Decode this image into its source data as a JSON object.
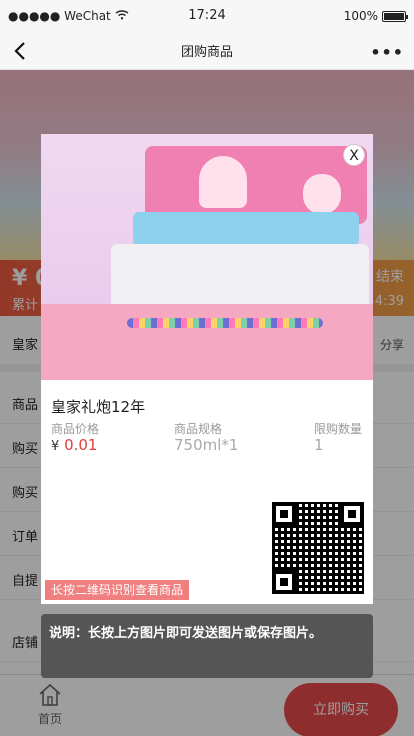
{
  "status_bar": {
    "carrier": "●●●●● WeChat",
    "time": "17:24",
    "battery": "100%"
  },
  "nav": {
    "title": "团购商品",
    "more": "•••"
  },
  "hero_bar": {
    "price_prefix": "¥ 0",
    "sub": "累计",
    "end_label": "结束",
    "end_time": "4:39"
  },
  "title_row": {
    "title": "皇家",
    "share": "分享"
  },
  "list_rows": [
    "商品",
    "购买",
    "购买",
    "订单",
    "自提",
    "店铺"
  ],
  "tabbar": {
    "home": "首页",
    "buy": "立即购买"
  },
  "poster": {
    "close": "X",
    "product_name": "皇家礼炮12年",
    "price_label": "商品价格",
    "currency": "¥",
    "price": "0.01",
    "spec_label": "商品规格",
    "spec": "750ml*1",
    "limit_label": "限购数量",
    "limit": "1",
    "qr_tag": "长按二维码识别查看商品"
  },
  "tip": "说明：长按上方图片即可发送图片或保存图片。"
}
